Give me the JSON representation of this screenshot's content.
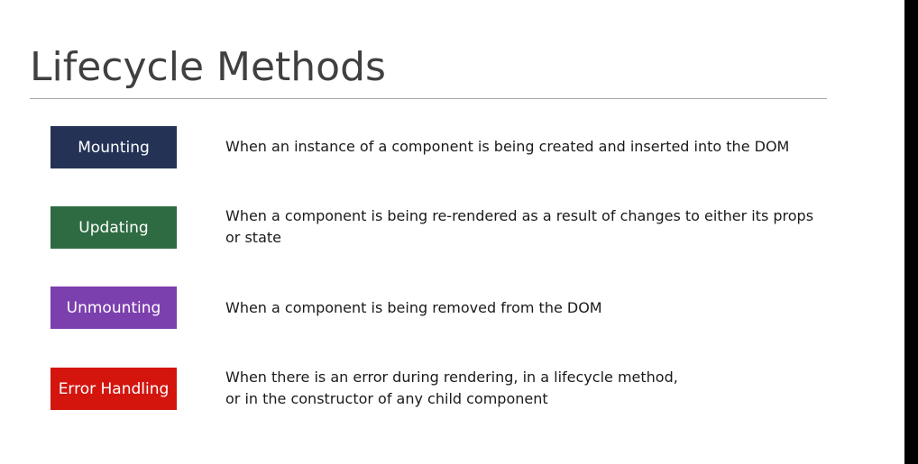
{
  "slide": {
    "title": "Lifecycle Methods"
  },
  "phases": [
    {
      "label": "Mounting",
      "color": "#243256",
      "description": [
        "When an instance of a component is being created and inserted into the DOM"
      ]
    },
    {
      "label": "Updating",
      "color": "#2e6b42",
      "description": [
        "When a component is being re-rendered as a result of changes to either its props",
        "or state"
      ]
    },
    {
      "label": "Unmounting",
      "color": "#7b3fae",
      "description": [
        "When a component is being removed from the DOM"
      ]
    },
    {
      "label": "Error Handling",
      "color": "#d3150e",
      "description": [
        "When there is an error during rendering, in a lifecycle method,",
        "or in the constructor of any child component"
      ]
    }
  ]
}
